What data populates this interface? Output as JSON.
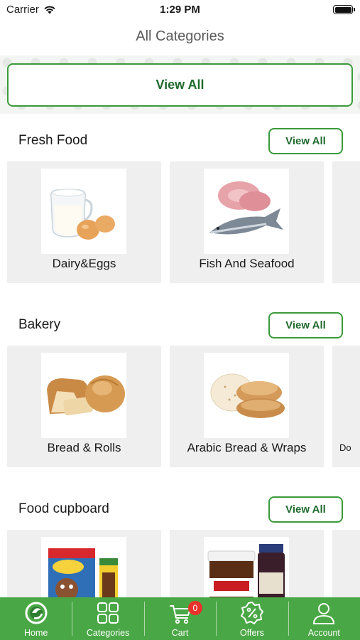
{
  "status_bar": {
    "carrier": "Carrier",
    "time": "1:29 PM"
  },
  "header": {
    "title": "All Categories"
  },
  "banner": {
    "view_all_label": "View All"
  },
  "sections": [
    {
      "title": "Fresh Food",
      "view_all_label": "View All",
      "cards": [
        {
          "label": "Dairy&Eggs",
          "icon": "dairy-eggs-image"
        },
        {
          "label": "Fish And Seafood",
          "icon": "fish-image"
        }
      ],
      "peek_label": ""
    },
    {
      "title": "Bakery",
      "view_all_label": "View All",
      "cards": [
        {
          "label": "Bread & Rolls",
          "icon": "bread-image"
        },
        {
          "label": "Arabic Bread & Wraps",
          "icon": "arabic-bread-image"
        }
      ],
      "peek_label": "Do"
    },
    {
      "title": "Food cupboard",
      "view_all_label": "View All",
      "cards": [
        {
          "label": "",
          "icon": "cereal-image"
        },
        {
          "label": "",
          "icon": "spreads-image"
        }
      ],
      "peek_label": ""
    }
  ],
  "bottom_nav": {
    "items": [
      {
        "label": "Home",
        "icon": "home-logo-icon"
      },
      {
        "label": "Categories",
        "icon": "grid-icon"
      },
      {
        "label": "Cart",
        "icon": "cart-icon",
        "badge": "0"
      },
      {
        "label": "Offers",
        "icon": "offers-percent-icon"
      },
      {
        "label": "Account",
        "icon": "user-icon"
      }
    ]
  },
  "colors": {
    "brand_green": "#4aa745",
    "button_border": "#3a9a3a",
    "button_text": "#1f6a2e",
    "card_bg": "#efefef",
    "badge_red": "#e8322b"
  }
}
